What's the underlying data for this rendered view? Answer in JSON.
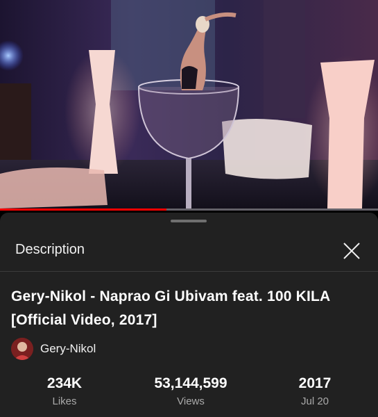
{
  "player": {
    "progress_fraction": 0.44
  },
  "panel": {
    "title": "Description",
    "close_icon": "close-icon"
  },
  "video": {
    "title_line1": "Gery-Nikol - Naprao Gi Ubivam feat. 100 KILA",
    "title_line2": "[Official Video, 2017]",
    "channel": "Gery-Nikol"
  },
  "stats": [
    {
      "value": "234K",
      "label": "Likes"
    },
    {
      "value": "53,144,599",
      "label": "Views"
    },
    {
      "value": "2017",
      "label": "Jul 20"
    }
  ],
  "colors": {
    "accent": "#ff0000",
    "sheet_bg": "#212121",
    "secondary_text": "#aaaaaa"
  }
}
